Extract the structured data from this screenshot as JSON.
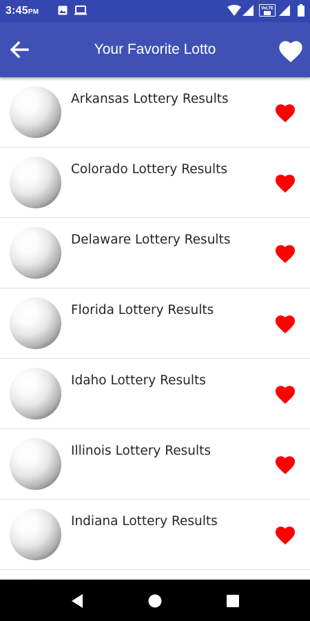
{
  "status_bar": {
    "time": "3:45",
    "ampm": "PM",
    "icons": [
      "image-icon",
      "laptop-icon",
      "wifi-icon",
      "signal-icon",
      "volte-icon",
      "signal-icon",
      "battery-icon"
    ],
    "volte_text": "VoLTE"
  },
  "app_bar": {
    "title": "Your Favorite Lotto",
    "back_icon": "arrow-back-icon",
    "favorite_icon": "heart-icon"
  },
  "colors": {
    "status_bar": "#3447b0",
    "app_bar": "#3f51b5",
    "heart": "#ff0000",
    "nav_bar": "#000000"
  },
  "list": {
    "items": [
      {
        "label": "Arkansas Lottery Results",
        "favorite": true
      },
      {
        "label": "Colorado Lottery Results",
        "favorite": true
      },
      {
        "label": "Delaware Lottery Results",
        "favorite": true
      },
      {
        "label": "Florida Lottery Results",
        "favorite": true
      },
      {
        "label": "Idaho Lottery Results",
        "favorite": true
      },
      {
        "label": "Illinois Lottery Results",
        "favorite": true
      },
      {
        "label": "Indiana Lottery Results",
        "favorite": true
      },
      {
        "label": "",
        "favorite": true
      }
    ]
  },
  "nav_bar": {
    "buttons": [
      "back-triangle-icon",
      "home-circle-icon",
      "recents-square-icon"
    ]
  }
}
